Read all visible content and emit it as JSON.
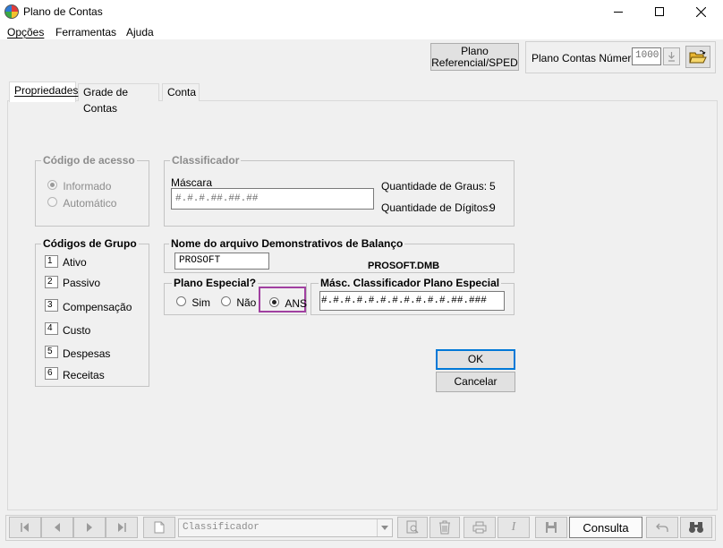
{
  "window": {
    "title": "Plano de Contas",
    "minimize_glyph": "—",
    "maximize_glyph": "☐",
    "close_glyph": "✕"
  },
  "menu": {
    "items": [
      {
        "label": "Opções"
      },
      {
        "label": "Ferramentas"
      },
      {
        "label": "Ajuda"
      }
    ]
  },
  "toolbar": {
    "plano_ref_line1": "Plano",
    "plano_ref_line2": "Referencial/SPED",
    "plano_contas_numero_label": "Plano Contas Número",
    "plano_contas_numero_value": "1000"
  },
  "tabs": [
    {
      "label": "Propriedades",
      "active": true
    },
    {
      "label": "Grade de Contas",
      "active": false
    },
    {
      "label": "Conta",
      "active": false
    }
  ],
  "codigo_acesso": {
    "title": "Código de acesso",
    "options": [
      {
        "label": "Informado",
        "checked": true
      },
      {
        "label": "Automático",
        "checked": false
      }
    ]
  },
  "classificador": {
    "title": "Classificador",
    "mascara_label": "Máscara",
    "mascara_value": "#.#.#.##.##.##",
    "graus_label": "Quantidade de Graus:",
    "graus_value": "5",
    "digitos_label": "Quantidade de Dígitos:",
    "digitos_value": "9"
  },
  "codigos_grupo": {
    "title": "Códigos de Grupo",
    "items": [
      {
        "code": "1",
        "label": "Ativo"
      },
      {
        "code": "2",
        "label": "Passivo"
      },
      {
        "code": "3",
        "label": "Compensação"
      },
      {
        "code": "4",
        "label": "Custo"
      },
      {
        "code": "5",
        "label": "Despesas"
      },
      {
        "code": "6",
        "label": "Receitas"
      }
    ]
  },
  "demonstrativos": {
    "title": "Nome do arquivo Demonstrativos de Balanço",
    "input_value": "PROSOFT",
    "file_name": "PROSOFT.DMB"
  },
  "plano_especial": {
    "title": "Plano Especial?",
    "options": [
      {
        "label": "Sim",
        "checked": false
      },
      {
        "label": "Não",
        "checked": false
      },
      {
        "label": "ANS",
        "checked": true
      }
    ],
    "highlight_color": "#a040a0"
  },
  "masc_especial": {
    "title": "Másc. Classificador Plano Especial",
    "value": "#.#.#.#.#.#.#.#.#.#.#.##.###"
  },
  "actions": {
    "ok_label": "OK",
    "cancel_label": "Cancelar"
  },
  "navbar": {
    "combo_value": "Classificador",
    "consulta_label": "Consulta",
    "accent": "#0078d7"
  }
}
